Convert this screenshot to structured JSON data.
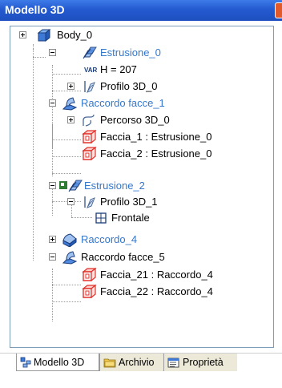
{
  "window": {
    "title": "Modello 3D"
  },
  "tree": [
    {
      "label": "Body_0"
    },
    {
      "label": "Estrusione_0"
    },
    {
      "label": "H = 207",
      "badge": "VAR"
    },
    {
      "label": "Profilo 3D_0"
    },
    {
      "label": "Raccordo facce_1"
    },
    {
      "label": "Percorso 3D_0"
    },
    {
      "label": "Faccia_1 : Estrusione_0"
    },
    {
      "label": "Faccia_2 : Estrusione_0"
    },
    {
      "label": "Estrusione_2"
    },
    {
      "label": "Profilo 3D_1"
    },
    {
      "label": "Frontale"
    },
    {
      "label": "Raccordo_4"
    },
    {
      "label": "Raccordo facce_5"
    },
    {
      "label": "Faccia_21 : Raccordo_4"
    },
    {
      "label": "Faccia_22 : Raccordo_4"
    }
  ],
  "tabs": [
    {
      "label": "Modello 3D",
      "active": true
    },
    {
      "label": "Archivio"
    },
    {
      "label": "Proprietà"
    }
  ],
  "colors": {
    "title_bar": "#245ad0",
    "link_blue": "#3377cc",
    "face_red": "#e0322b"
  }
}
